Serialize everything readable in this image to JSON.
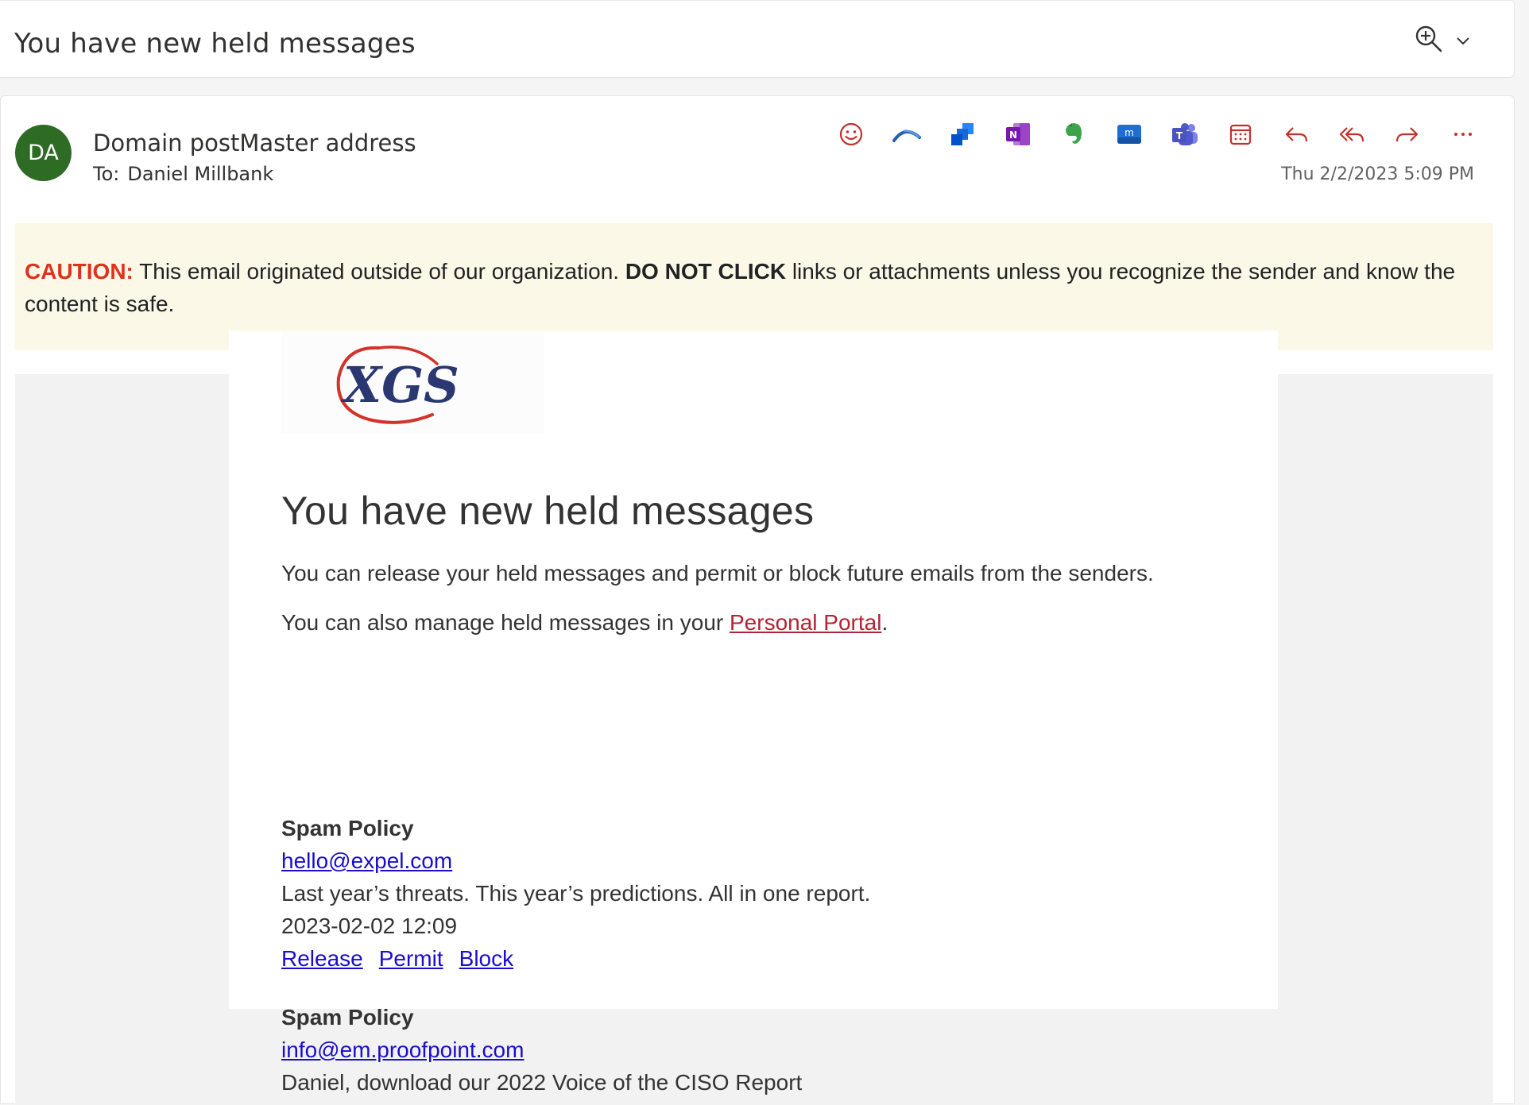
{
  "subject_bar": {
    "title": "You have new held messages"
  },
  "header": {
    "avatar_initials": "DA",
    "sender": "Domain postMaster address",
    "to_label": "To:",
    "to_name": "Daniel Millbank",
    "timestamp": "Thu 2/2/2023 5:09 PM"
  },
  "toolbar": [
    {
      "icon": "emoji-icon"
    },
    {
      "icon": "arc-icon"
    },
    {
      "icon": "jira-icon"
    },
    {
      "icon": "onenote-icon"
    },
    {
      "icon": "evernote-icon"
    },
    {
      "icon": "mimecast-icon"
    },
    {
      "icon": "teams-icon"
    },
    {
      "icon": "calendar-icon"
    },
    {
      "icon": "reply-icon"
    },
    {
      "icon": "reply-all-icon"
    },
    {
      "icon": "forward-icon"
    },
    {
      "icon": "more-icon"
    }
  ],
  "caution": {
    "label": "CAUTION:",
    "text1": " This email originated outside of our organization. ",
    "bold": "DO NOT CLICK",
    "text2": " links or attachments unless you recognize the sender and know the content is safe."
  },
  "body": {
    "logo_text": "XGS",
    "heading": "You have new held messages",
    "para1": "You can release your held messages and permit or block future emails from the senders.",
    "para2_prefix": "You can also manage held messages in your ",
    "portal_link": "Personal Portal",
    "para2_suffix": ".",
    "held": [
      {
        "policy": "Spam Policy",
        "sender": "hello@expel.com",
        "subject": "Last year’s threats. This year’s predictions. All in one report.",
        "date": "2023-02-02 12:09",
        "actions": [
          "Release",
          "Permit",
          "Block"
        ]
      },
      {
        "policy": "Spam Policy",
        "sender": "info@em.proofpoint.com",
        "subject": "Daniel, download our 2022 Voice of the CISO Report"
      }
    ]
  },
  "colors": {
    "avatar": "#2e6b25",
    "caution_bg": "#fbf8e8",
    "caution_label": "#e0311b",
    "portal_link": "#b02434",
    "link": "#1a0dcc",
    "toolbar_red": "#c4302b"
  }
}
